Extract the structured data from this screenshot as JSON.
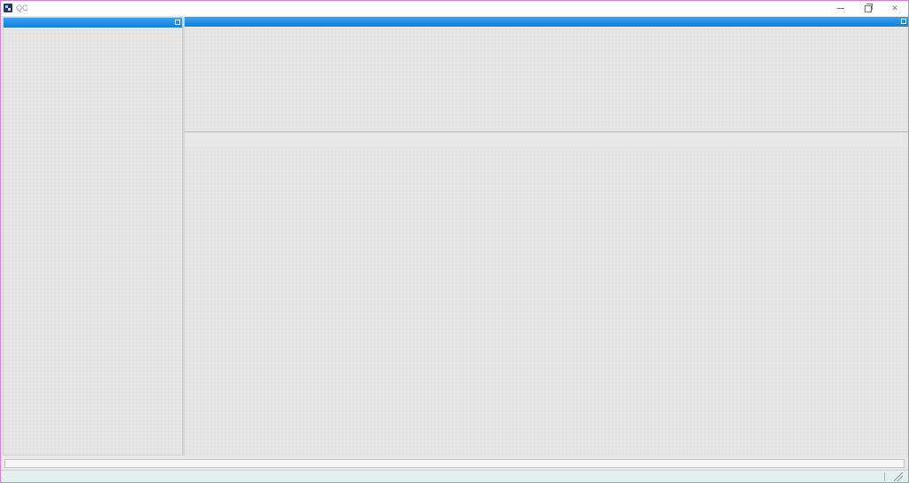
{
  "window": {
    "title": "QC",
    "accent_color": "#1a88e6",
    "border_color": "#e07ad8"
  },
  "titlebar": {
    "app_icon": "app-logo-icon",
    "minimize_icon": "minimize-icon",
    "maximize_icon": "restore-icon",
    "close_icon": "close-icon",
    "close_label": "✕"
  },
  "panels": {
    "left": {
      "float_icon": "dock-float-icon"
    },
    "top_right": {
      "float_icon": "dock-float-icon"
    },
    "bottom_right": {}
  },
  "command": {
    "value": "",
    "placeholder": ""
  },
  "statusbar": {
    "text": "",
    "grip_icon": "resize-grip-icon"
  }
}
